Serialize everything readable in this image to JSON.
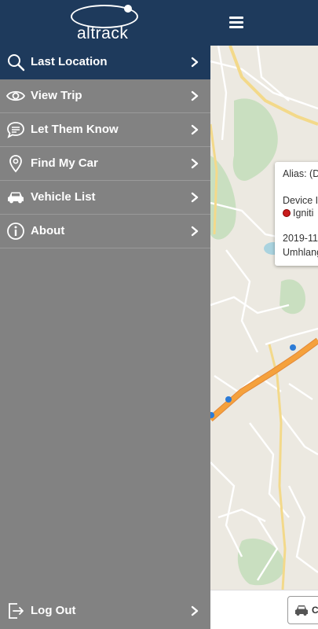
{
  "header": {
    "logo_text": "altrack",
    "menu_icon": "hamburger-icon"
  },
  "drawer": {
    "items": [
      {
        "label": "Last Location",
        "icon": "search-icon",
        "active": true
      },
      {
        "label": "View Trip",
        "icon": "eye-icon",
        "active": false
      },
      {
        "label": "Let Them Know",
        "icon": "chat-bubble-icon",
        "active": false
      },
      {
        "label": "Find My Car",
        "icon": "location-pin-icon",
        "active": false
      },
      {
        "label": "Vehicle List",
        "icon": "car-icon",
        "active": false
      },
      {
        "label": "About",
        "icon": "info-icon",
        "active": false
      }
    ],
    "logout": {
      "label": "Log Out",
      "icon": "logout-icon"
    }
  },
  "popup": {
    "alias": "Alias: (D",
    "device": "Device I",
    "ignition": "Igniti",
    "date": "2019-11",
    "place": "Umhlang"
  },
  "car_chip": {
    "label": "C",
    "icon": "car-icon"
  },
  "colors": {
    "header": "#1e3a5c",
    "drawer": "#828282",
    "active_item": "#1e3a5c",
    "road_major": "#f5a13c",
    "status_dot": "#c91c1c"
  }
}
